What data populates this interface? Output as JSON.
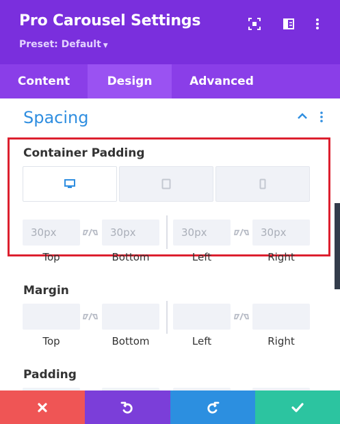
{
  "header": {
    "title": "Pro Carousel Settings",
    "preset_label": "Preset: Default",
    "bg_color": "#7a2fdd",
    "icons": [
      "focus-icon",
      "split-view-icon",
      "more-vertical-icon"
    ]
  },
  "tabs": [
    {
      "label": "Content",
      "active": false
    },
    {
      "label": "Design",
      "active": true
    },
    {
      "label": "Advanced",
      "active": false
    }
  ],
  "section": {
    "title": "Spacing",
    "accent": "#2f8ee0"
  },
  "container_padding": {
    "label": "Container Padding",
    "devices": [
      "desktop-icon",
      "tablet-icon",
      "phone-icon"
    ],
    "active_device": "desktop",
    "fields": [
      {
        "label": "Top",
        "value": "30px"
      },
      {
        "label": "Bottom",
        "value": "30px"
      },
      {
        "label": "Left",
        "value": "30px"
      },
      {
        "label": "Right",
        "value": "30px"
      }
    ]
  },
  "margin": {
    "label": "Margin",
    "fields": [
      {
        "label": "Top",
        "value": ""
      },
      {
        "label": "Bottom",
        "value": ""
      },
      {
        "label": "Left",
        "value": ""
      },
      {
        "label": "Right",
        "value": ""
      }
    ]
  },
  "padding": {
    "label": "Padding"
  },
  "footer": {
    "buttons": [
      {
        "name": "cancel",
        "icon": "close-icon",
        "color": "#ef5555"
      },
      {
        "name": "undo",
        "icon": "undo-icon",
        "color": "#7b3ed9"
      },
      {
        "name": "redo",
        "icon": "redo-icon",
        "color": "#2c8fe0"
      },
      {
        "name": "save",
        "icon": "check-icon",
        "color": "#2cc4a0"
      }
    ]
  }
}
